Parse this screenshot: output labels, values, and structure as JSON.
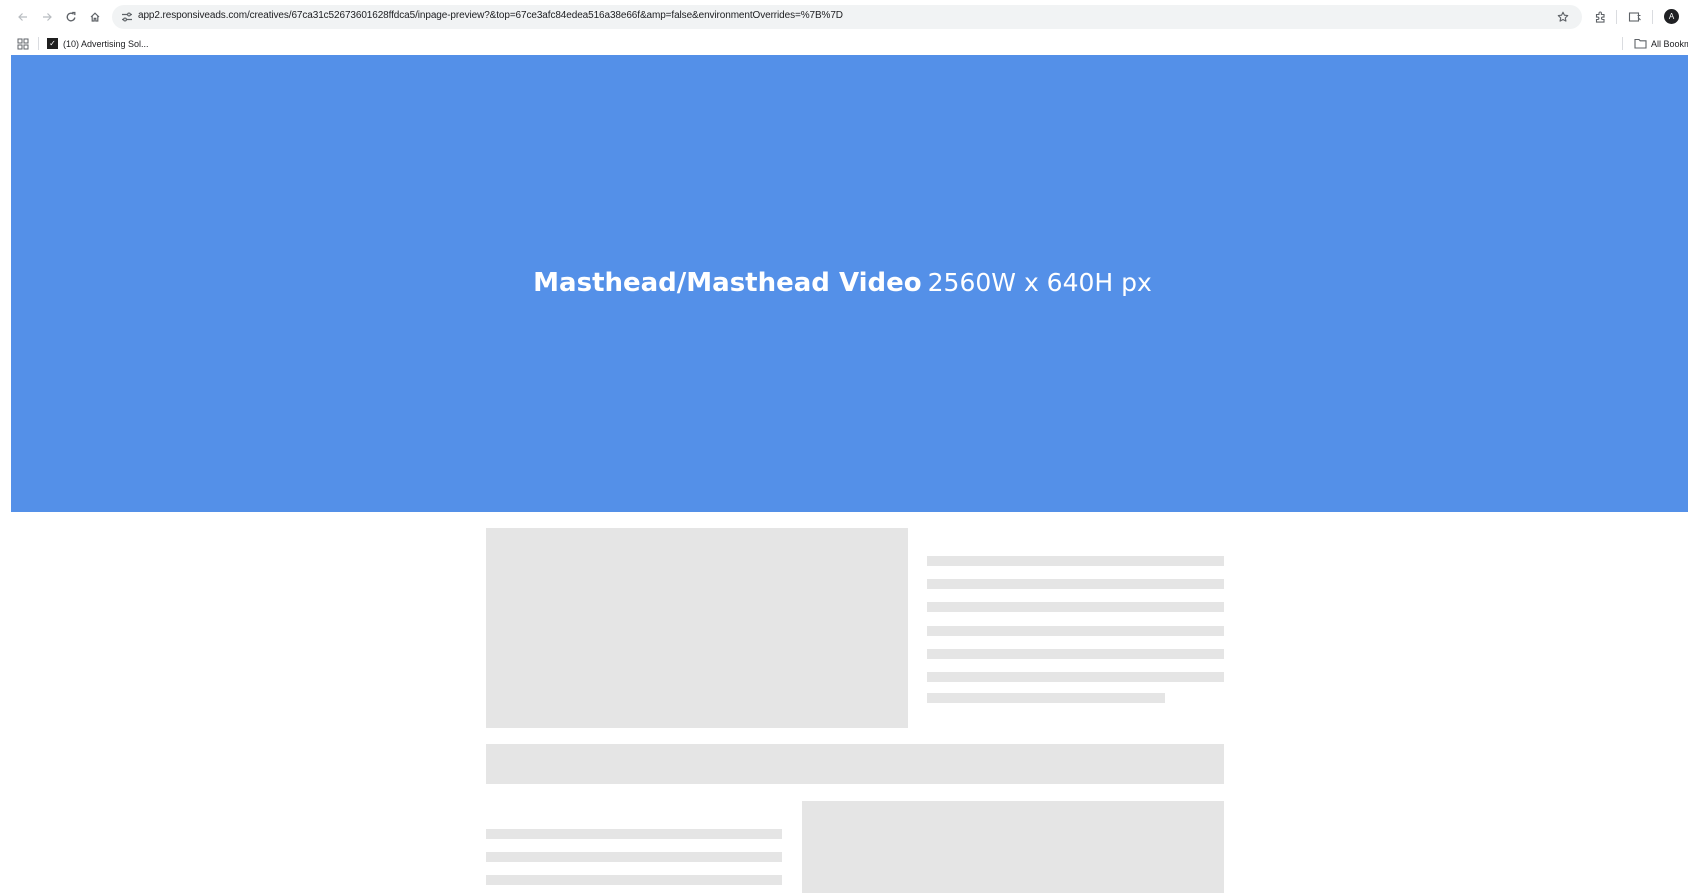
{
  "browser": {
    "url": "app2.responsiveads.com/creatives/67ca31c52673601628ffdca5/inpage-preview?&top=67ce3afc84edea516a38e66f&amp=false&environmentOverrides=%7B%7D",
    "avatar_initial": "A",
    "icons": [
      "back-icon",
      "forward-icon",
      "reload-icon",
      "home-icon",
      "site-info-icon",
      "star-icon",
      "extensions-icon",
      "reading-mode-icon"
    ]
  },
  "bookmarks_bar": {
    "items": [
      {
        "label": "(10) Advertising Sol...",
        "icon": "favicon"
      }
    ],
    "all_bookmarks_label": "All Bookmarks"
  },
  "page": {
    "masthead": {
      "title": "Masthead/Masthead Video",
      "dimensions": "2560W x 640H px",
      "background": "#5490e8"
    },
    "placeholder_color": "#e5e5e5"
  }
}
